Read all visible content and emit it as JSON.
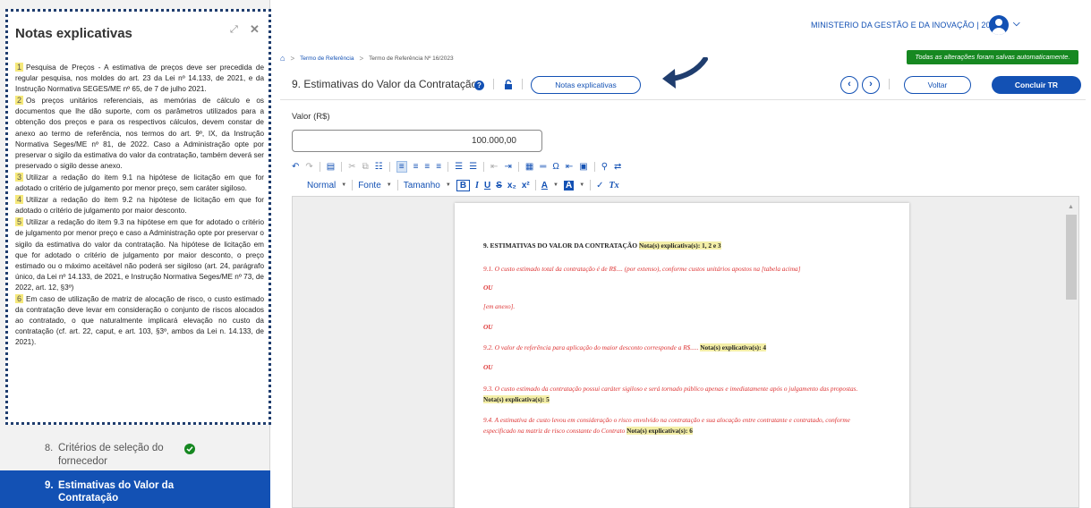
{
  "header": {
    "org": "MINISTERIO DA GESTÃO E DA INOVAÇÃO | 200999",
    "chevron": "⌄"
  },
  "breadcrumb": {
    "items": [
      "Termo de Referência",
      "Termo de Referência Nº 16/2023"
    ],
    "sep": ">"
  },
  "status": {
    "saved": "Todas as alterações foram salvas automaticamente."
  },
  "section": {
    "title": "9. Estimativas do Valor da Contratação",
    "help": "?",
    "notes_button": "Notas explicativas",
    "prev": "‹",
    "next": "›",
    "back_button": "Voltar",
    "finish_button": "Concluir TR"
  },
  "valor": {
    "label": "Valor (R$)",
    "value": "100.000,00"
  },
  "toolbar": {
    "format": "Normal",
    "font": "Fonte",
    "size": "Tamanho",
    "bold": "B",
    "italic": "I",
    "underline": "U",
    "strike": "S",
    "sub": "x₂",
    "sup": "x²",
    "textcolor": "A",
    "bgcolor": "A",
    "clear": "Tx"
  },
  "document": {
    "heading": "9. ESTIMATIVAS DO VALOR DA CONTRATAÇÃO",
    "heading_notes": "Nota(s) explicativa(s): 1, 2 e 3",
    "p1": "9.1. O custo estimado total da contratação é de R$.... (por extenso), conforme custos unitários apostos na [tabela acima]",
    "ou": "OU",
    "p2": "[em anexo].",
    "p3": "9.2. O valor de referência para aplicação do maior desconto corresponde a R$.....",
    "p3_notes": "Nota(s) explicativa(s): 4",
    "p4": "9.3. O custo estimado da contratação possui caráter sigiloso e será tornado público apenas e imediatamente após o julgamento das propostas.",
    "p4_notes": "Nota(s) explicativa(s): 5",
    "p5": "9.4. A estimativa de custo levou em consideração o risco envolvido na contratação e sua alocação entre contratante e contratado, conforme especificado na matriz de risco constante do Contrato",
    "p5_notes": "Nota(s) explicativa(s): 6"
  },
  "notes": {
    "title": "Notas explicativas",
    "expand": "⤢",
    "close": "✕",
    "items": [
      {
        "n": "1",
        "text": "Pesquisa de Preços - A estimativa de preços deve ser precedida de regular pesquisa, nos moldes do art. 23 da Lei nº 14.133, de 2021, e da Instrução Normativa SEGES/ME nº 65, de 7 de julho 2021."
      },
      {
        "n": "2",
        "text": "Os preços unitários referenciais, as memórias de cálculo e os documentos que lhe dão suporte, com os parâmetros utilizados para a obtenção dos preços e para os respectivos cálculos, devem constar de anexo ao termo de referência, nos termos do art. 9º, IX, da Instrução Normativa Seges/ME nº 81, de 2022. Caso a Administração opte por preservar o sigilo da estimativa do valor da contratação, também deverá ser preservado o sigilo desse anexo."
      },
      {
        "n": "3",
        "text": "Utilizar a redação do item 9.1 na hipótese de licitação em que for adotado o critério de julgamento por menor preço, sem caráter sigiloso."
      },
      {
        "n": "4",
        "text": "Utilizar a redação do item 9.2 na hipótese de licitação em que for adotado o critério de julgamento por maior desconto."
      },
      {
        "n": "5",
        "text": "Utilizar a redação do item 9.3 na hipótese em que for adotado o critério de julgamento por menor preço e caso a Administração opte por preservar o sigilo da estimativa do valor da contratação. Na hipótese de licitação em que for adotado o critério de julgamento por maior desconto, o preço estimado ou o máximo aceitável não poderá ser sigiloso (art. 24, parágrafo único, da Lei nº 14.133, de 2021, e Instrução Normativa Seges/ME nº 73, de 2022, art. 12, §3º)"
      },
      {
        "n": "6",
        "text": "Em caso de utilização de matriz de alocação de risco, o custo estimado da contratação deve levar em consideração o conjunto de riscos alocados ao contratado, o que naturalmente implicará elevação no custo da contratação (cf. art. 22, caput, e art. 103, §3º, ambos da Lei n. 14.133, de 2021)."
      }
    ]
  },
  "sidebar": {
    "items": [
      {
        "num": "8.",
        "label": "Critérios de seleção do fornecedor",
        "done": true
      },
      {
        "num": "9.",
        "label": "Estimativas do Valor da Contratação",
        "active": true
      }
    ]
  },
  "colors": {
    "primary": "#1351b4",
    "success": "#168821",
    "highlight": "#f5e87a",
    "draft_text": "#d33333"
  }
}
